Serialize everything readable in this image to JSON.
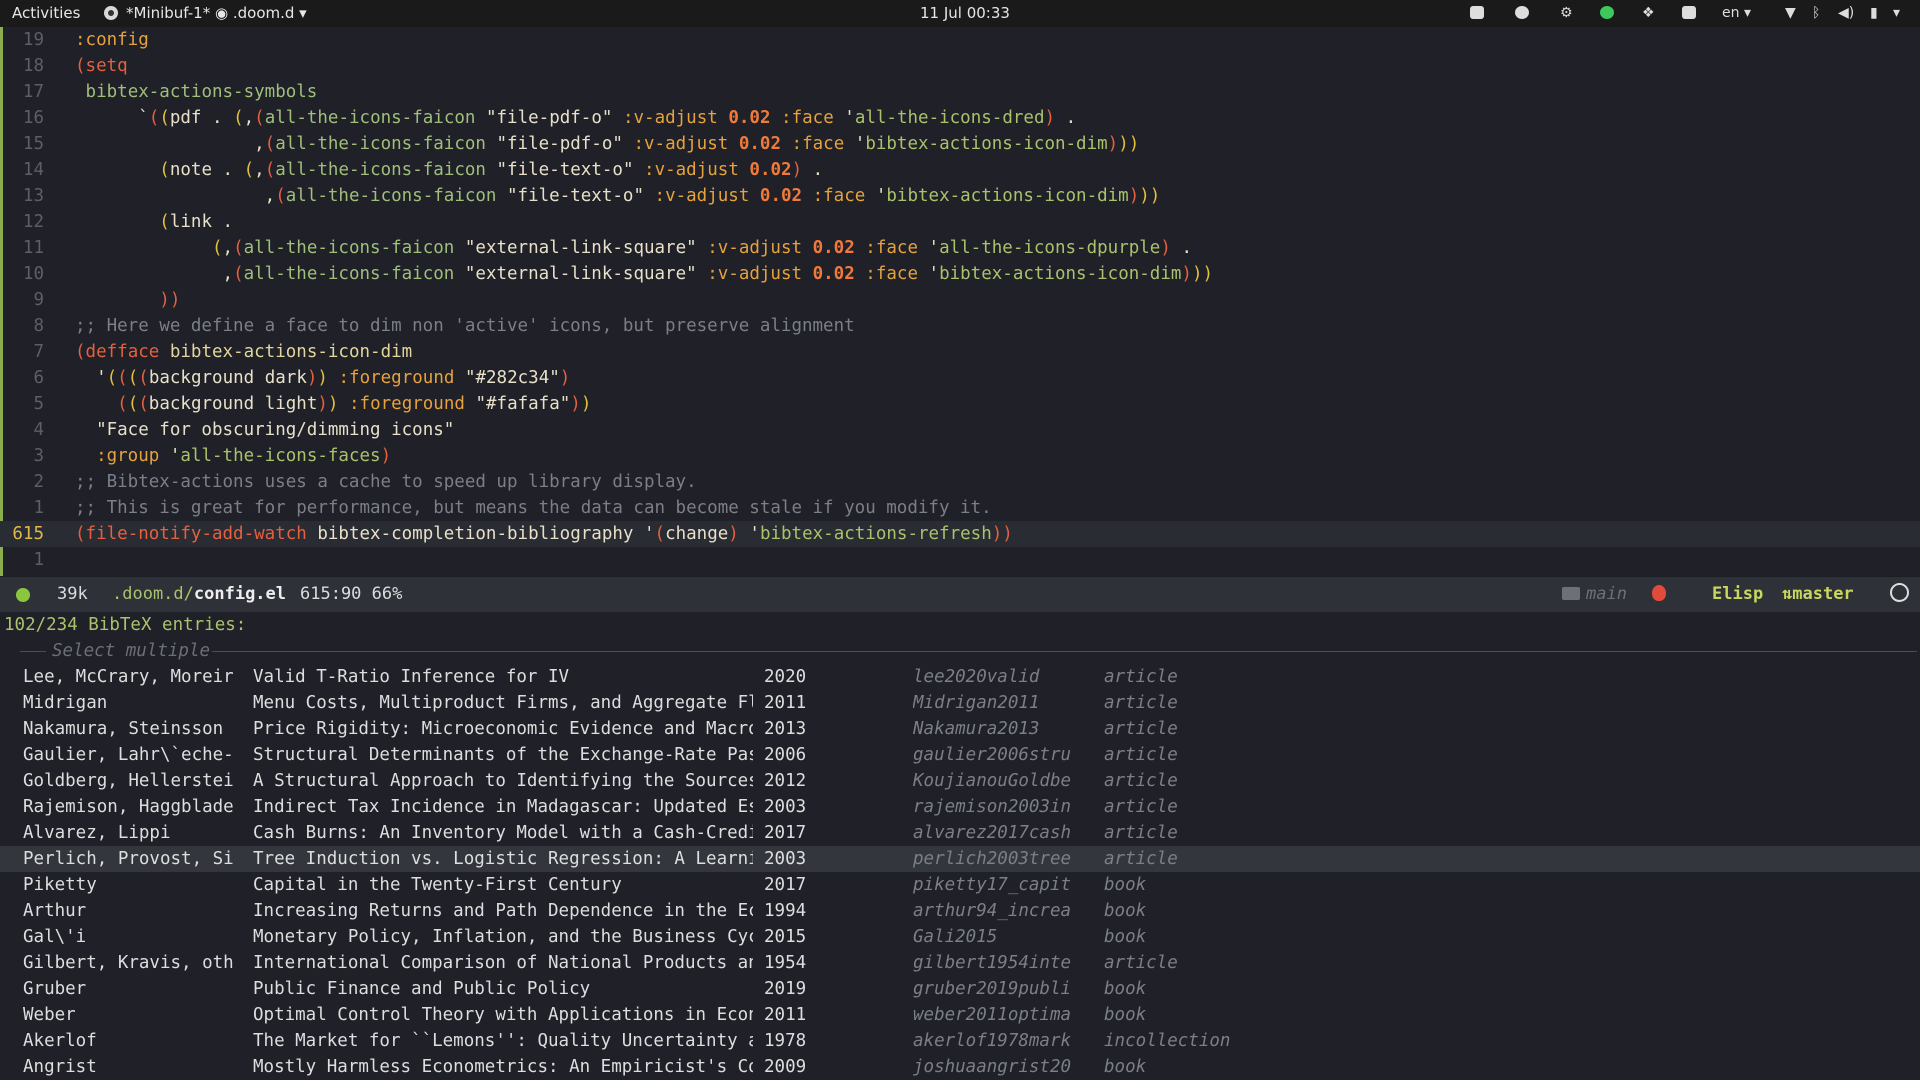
{
  "topbar": {
    "activities": "Activities",
    "app": "*Minibuf-1* ◉ .doom.d",
    "clock": "11 Jul  00:33",
    "lang": "en"
  },
  "editor": {
    "lines": [
      {
        "n": "19",
        "html": "<span class='key'>:config</span>"
      },
      {
        "n": "18",
        "html": "<span class='pl'>(</span><span class='kw'>setq</span>"
      },
      {
        "n": "17",
        "html": " <span class='sym'>bibtex-actions-symbols</span>"
      },
      {
        "n": "16",
        "html": "      <span class='str'>`</span><span class='pl'>(</span><span class='pp'>(</span><span class='str'>pdf . </span><span class='pp'>(</span><span class='str'>,</span><span class='pl'>(</span><span class='sym'>all-the-icons-faicon</span> <span class='str'>\"file-pdf-o\"</span> <span class='key'>:v-adjust</span> <span class='num'>0.02</span> <span class='key'>:face</span> <span class='str'>'</span><span class='qs'>all-the-icons-dred</span><span class='pl'>)</span> <span class='str'>.</span>"
      },
      {
        "n": "15",
        "html": "                 <span class='str'>,</span><span class='pl'>(</span><span class='sym'>all-the-icons-faicon</span> <span class='str'>\"file-pdf-o\"</span> <span class='key'>:v-adjust</span> <span class='num'>0.02</span> <span class='key'>:face</span> <span class='str'>'</span><span class='qs'>bibtex-actions-icon-dim</span><span class='pl'>)</span><span class='pp'>))</span>"
      },
      {
        "n": "14",
        "html": "        <span class='pp'>(</span><span class='str'>note . </span><span class='pp'>(</span><span class='str'>,</span><span class='pl'>(</span><span class='sym'>all-the-icons-faicon</span> <span class='str'>\"file-text-o\"</span> <span class='key'>:v-adjust</span> <span class='num'>0.02</span><span class='pl'>)</span> <span class='str'>.</span>"
      },
      {
        "n": "13",
        "html": "                  <span class='str'>,</span><span class='pl'>(</span><span class='sym'>all-the-icons-faicon</span> <span class='str'>\"file-text-o\"</span> <span class='key'>:v-adjust</span> <span class='num'>0.02</span> <span class='key'>:face</span> <span class='str'>'</span><span class='qs'>bibtex-actions-icon-dim</span><span class='pl'>)</span><span class='pp'>))</span>"
      },
      {
        "n": "12",
        "html": "        <span class='pp'>(</span><span class='str'>link .</span>"
      },
      {
        "n": "11",
        "html": "             <span class='pp'>(</span><span class='str'>,</span><span class='pl'>(</span><span class='sym'>all-the-icons-faicon</span> <span class='str'>\"external-link-square\"</span> <span class='key'>:v-adjust</span> <span class='num'>0.02</span> <span class='key'>:face</span> <span class='str'>'</span><span class='qs'>all-the-icons-dpurple</span><span class='pl'>)</span> <span class='str'>.</span>"
      },
      {
        "n": "10",
        "html": "              <span class='str'>,</span><span class='pl'>(</span><span class='sym'>all-the-icons-faicon</span> <span class='str'>\"external-link-square\"</span> <span class='key'>:v-adjust</span> <span class='num'>0.02</span> <span class='key'>:face</span> <span class='str'>'</span><span class='qs'>bibtex-actions-icon-dim</span><span class='pl'>)</span><span class='pp'>))</span>"
      },
      {
        "n": "9",
        "html": "        <span class='pl'>))</span>"
      },
      {
        "n": "8",
        "html": "<span class='cm'>;; Here we define a face to dim non 'active' icons, but preserve alignment</span>"
      },
      {
        "n": "7",
        "html": "<span class='pl'>(</span><span class='kw'>defface</span> <span class='fn'>bibtex-actions-icon-dim</span>"
      },
      {
        "n": "6",
        "html": "  <span class='str'>'</span><span class='pp'>(</span><span class='pl'>(</span><span class='pp'>(</span><span class='pl'>(</span><span class='str'>background dark</span><span class='pl'>)</span><span class='pp'>)</span> <span class='key'>:foreground</span> <span class='str'>\"#282c34\"</span><span class='pl'>)</span>"
      },
      {
        "n": "5",
        "html": "    <span class='pl'>(</span><span class='pp'>(</span><span class='pl'>(</span><span class='str'>background light</span><span class='pl'>)</span><span class='pp'>)</span> <span class='key'>:foreground</span> <span class='str'>\"#fafafa\"</span><span class='pl'>)</span><span class='pp'>)</span>"
      },
      {
        "n": "4",
        "html": "  <span class='str'>\"Face for obscuring/dimming icons\"</span>"
      },
      {
        "n": "3",
        "html": "  <span class='key'>:group</span> <span class='str'>'</span><span class='qs'>all-the-icons-faces</span><span class='pl'>)</span>"
      },
      {
        "n": "2",
        "html": "<span class='cm'>;; Bibtex-actions uses a cache to speed up library display.</span>"
      },
      {
        "n": "1",
        "html": "<span class='cm'>;; This is great for performance, but means the data can become stale if you modify it.</span>"
      },
      {
        "n": "615",
        "current": true,
        "html": "<span class='pl'>(</span><span class='kw'>file-notify-add-watch</span> <span class='str'>bibtex-completion-bibliography</span> <span class='str'>'</span><span class='pl'>(</span><span class='str'>change</span><span class='pl'>)</span> <span class='str'>'</span><span class='qs'>bibtex-actions-refresh</span><span class='pl'>))</span>"
      },
      {
        "n": "1",
        "html": ""
      }
    ]
  },
  "modeline": {
    "size": "39k",
    "path_dir": ".doom.d/",
    "path_file": "config.el",
    "position": "615:90 66%",
    "workspace": "main",
    "mode": "Elisp",
    "branch": "master"
  },
  "minibuffer": {
    "header": "102/234 BibTeX entries:",
    "separator_label": "Select multiple",
    "entries": [
      {
        "author": "Lee, McCrary, Moreir",
        "title": "Valid T-Ratio Inference for IV",
        "year": "2020",
        "key": "lee2020valid",
        "type": "article"
      },
      {
        "author": "Midrigan",
        "title": "Menu Costs, Multiproduct Firms, and Aggregate Fl",
        "year": "2011",
        "key": "Midrigan2011",
        "type": "article"
      },
      {
        "author": "Nakamura, Steinsson",
        "title": "Price Rigidity: Microeconomic Evidence and Macro",
        "year": "2013",
        "key": "Nakamura2013",
        "type": "article"
      },
      {
        "author": "Gaulier, Lahr\\`eche-",
        "title": "Structural Determinants of the Exchange-Rate Pas",
        "year": "2006",
        "key": "gaulier2006stru",
        "type": "article"
      },
      {
        "author": "Goldberg, Hellerstei",
        "title": "A Structural Approach to Identifying the Sources",
        "year": "2012",
        "key": "KoujianouGoldbe",
        "type": "article"
      },
      {
        "author": "Rajemison, Haggblade",
        "title": "Indirect Tax Incidence in Madagascar: Updated Es",
        "year": "2003",
        "key": "rajemison2003in",
        "type": "article"
      },
      {
        "author": "Alvarez, Lippi",
        "title": "Cash Burns: An Inventory Model with a Cash-Credi",
        "year": "2017",
        "key": "alvarez2017cash",
        "type": "article"
      },
      {
        "author": "Perlich, Provost, Si",
        "title": "Tree Induction vs. Logistic Regression: A Learni",
        "year": "2003",
        "key": "perlich2003tree",
        "type": "article",
        "selected": true
      },
      {
        "author": "Piketty",
        "title": "Capital in the Twenty-First Century",
        "year": "2017",
        "key": "piketty17_capit",
        "type": "book"
      },
      {
        "author": "Arthur",
        "title": "Increasing Returns and Path Dependence in the Ec",
        "year": "1994",
        "key": "arthur94_increa",
        "type": "book"
      },
      {
        "author": "Gal\\'i",
        "title": "Monetary Policy, Inflation, and the Business Cyc",
        "year": "2015",
        "key": "Gali2015",
        "type": "book"
      },
      {
        "author": "Gilbert, Kravis, oth",
        "title": "International Comparison of National Products an",
        "year": "1954",
        "key": "gilbert1954inte",
        "type": "article"
      },
      {
        "author": "Gruber",
        "title": "Public Finance and Public Policy",
        "year": "2019",
        "key": "gruber2019publi",
        "type": "book"
      },
      {
        "author": "Weber",
        "title": "Optimal Control Theory with Applications in Econ",
        "year": "2011",
        "key": "weber2011optima",
        "type": "book"
      },
      {
        "author": "Akerlof",
        "title": "The Market for ``Lemons'': Quality Uncertainty a",
        "year": "1978",
        "key": "akerlof1978mark",
        "type": "incollection"
      },
      {
        "author": "Angrist",
        "title": "Mostly Harmless Econometrics: An Empiricist's Co",
        "year": "2009",
        "key": "joshuaangrist20",
        "type": "book"
      }
    ]
  }
}
